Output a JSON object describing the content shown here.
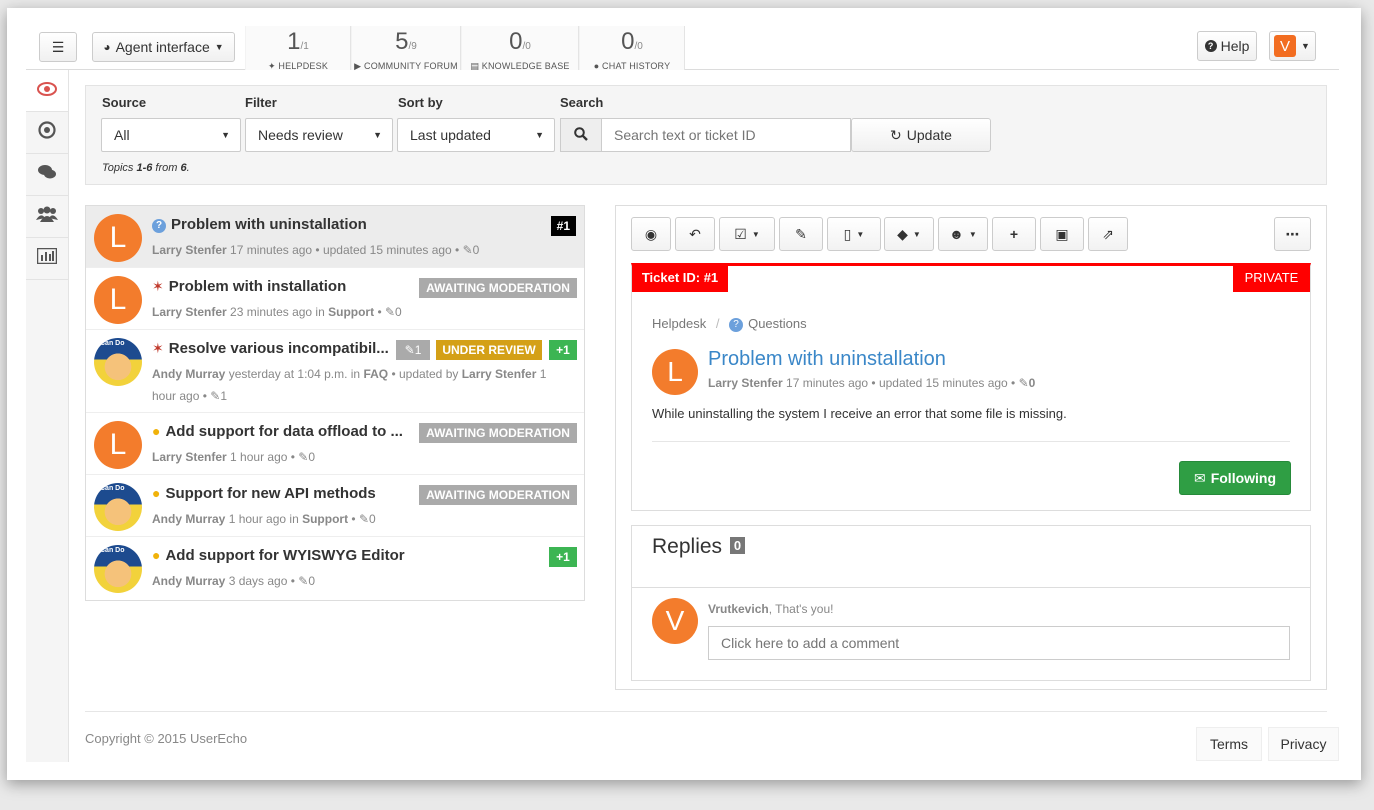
{
  "topbar": {
    "agent_label": "Agent interface",
    "counters": [
      {
        "num": "1",
        "total": "/1",
        "label": "HELPDESK",
        "icon": "pin-icon"
      },
      {
        "num": "5",
        "total": "/9",
        "label": "COMMUNITY FORUM",
        "icon": "megaphone-icon"
      },
      {
        "num": "0",
        "total": "/0",
        "label": "KNOWLEDGE BASE",
        "icon": "book-icon"
      },
      {
        "num": "0",
        "total": "/0",
        "label": "CHAT HISTORY",
        "icon": "chat-icon"
      }
    ],
    "help_label": "Help",
    "user_initial": "V"
  },
  "filters": {
    "source_label": "Source",
    "source_value": "All",
    "filter_label": "Filter",
    "filter_value": "Needs review",
    "sort_label": "Sort by",
    "sort_value": "Last updated",
    "search_label": "Search",
    "search_placeholder": "Search text or ticket ID",
    "update_label": "Update",
    "topics_prefix": "Topics ",
    "topics_range": "1-6",
    "topics_mid": " from ",
    "topics_total": "6",
    "topics_suffix": "."
  },
  "tickets": [
    {
      "title": "Problem with uninstallation",
      "author": "Larry Stenfer",
      "meta": " 17 minutes ago • updated 15 minutes ago • ",
      "comments": "0",
      "badge": "#1",
      "initial": "L"
    },
    {
      "title": "Problem with installation",
      "author": "Larry Stenfer",
      "meta": " 23 minutes ago in ",
      "where": "Support",
      "comments": "0",
      "badge": "AWAITING MODERATION",
      "initial": "L"
    },
    {
      "title": "Resolve various incompatibil...",
      "author": "Andy Murray",
      "meta": " yesterday at 1:04 p.m. in ",
      "where": "FAQ",
      "meta2": " • updated by ",
      "author2": "Larry Stenfer",
      "meta3": " 1 hour ago • ",
      "comments": "1",
      "comment_badge": "1",
      "badge": "UNDER REVIEW",
      "votes": "+1",
      "photo_text": "Can Do"
    },
    {
      "title": "Add support for data offload to ...",
      "author": "Larry Stenfer",
      "meta": " 1 hour ago • ",
      "comments": "0",
      "badge": "AWAITING MODERATION",
      "initial": "L"
    },
    {
      "title": "Support for new API methods",
      "author": "Andy Murray",
      "meta": " 1 hour ago in ",
      "where": "Support",
      "comments": "0",
      "badge": "AWAITING MODERATION",
      "photo_text": "Can Do"
    },
    {
      "title": "Add support for WYISWYG Editor",
      "author": "Andy Murray",
      "meta": " 3 days ago • ",
      "comments": "0",
      "votes": "+1",
      "photo_text": "Can Do"
    }
  ],
  "detail": {
    "ticket_id": "Ticket ID: #1",
    "private": "PRIVATE",
    "crumb1": "Helpdesk",
    "crumb_sep": "/",
    "crumb2": "Questions",
    "initial": "L",
    "title": "Problem with uninstallation",
    "author": "Larry Stenfer",
    "meta": " 17 minutes ago • updated 15 minutes ago • ",
    "comments": "0",
    "body": "While uninstalling the system I receive an error that some file is missing.",
    "follow_label": "Following",
    "replies_title": "Replies",
    "replies_count": "0",
    "reply_initial": "V",
    "reply_user": "Vrutkevich",
    "reply_note": ", That's you!",
    "comment_placeholder": "Click here to add a comment"
  },
  "footer": {
    "copyright": "Copyright © 2015 UserEcho",
    "terms": "Terms",
    "privacy": "Privacy"
  },
  "colors": {
    "accent_red": "#ff0000",
    "link_blue": "#3a87c8",
    "success_green": "#2f9e44",
    "avatar_orange": "#f37c2c",
    "review_gold": "#d4a017"
  }
}
